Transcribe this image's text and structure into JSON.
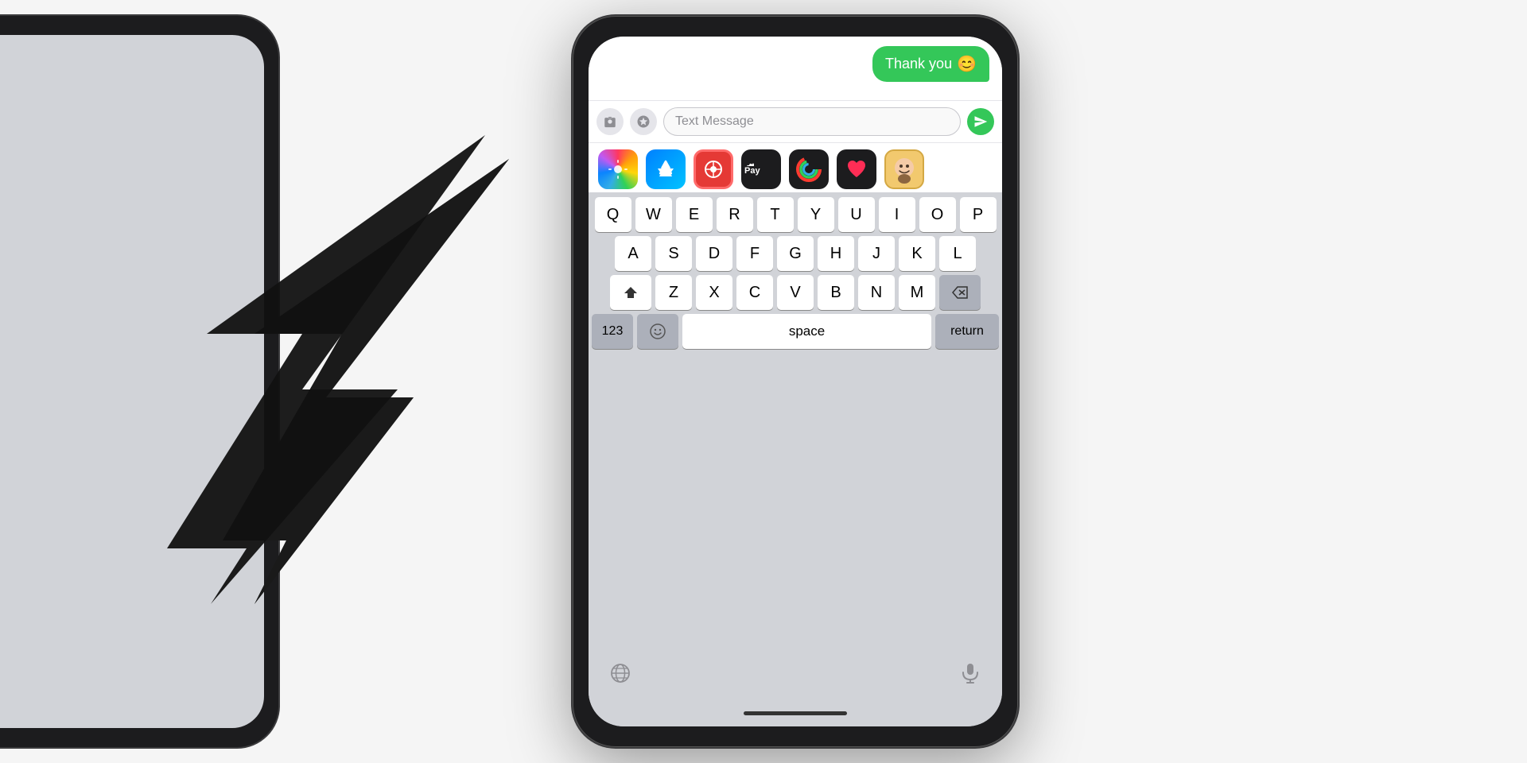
{
  "scene": {
    "background": "#f5f5f5"
  },
  "message": {
    "text": "Thank you",
    "emoji": "😊",
    "bubble_color": "#34c759"
  },
  "input": {
    "placeholder": "Text Message"
  },
  "app_icons": [
    {
      "name": "Photos",
      "id": "photos"
    },
    {
      "name": "App Store",
      "id": "appstore"
    },
    {
      "name": "Web Search",
      "id": "web"
    },
    {
      "name": "Apple Pay",
      "id": "applepay"
    },
    {
      "name": "Fitness",
      "id": "fitness"
    },
    {
      "name": "Heart",
      "id": "heart"
    },
    {
      "name": "Memoji",
      "id": "memoji"
    }
  ],
  "keyboard": {
    "rows": [
      [
        "Q",
        "W",
        "E",
        "R",
        "T",
        "Y",
        "U",
        "I",
        "O",
        "P"
      ],
      [
        "A",
        "S",
        "D",
        "F",
        "G",
        "H",
        "J",
        "K",
        "L"
      ],
      [
        "Z",
        "X",
        "C",
        "V",
        "B",
        "N",
        "M"
      ]
    ],
    "space_label": "space",
    "return_label": "return",
    "numbers_label": "123"
  }
}
